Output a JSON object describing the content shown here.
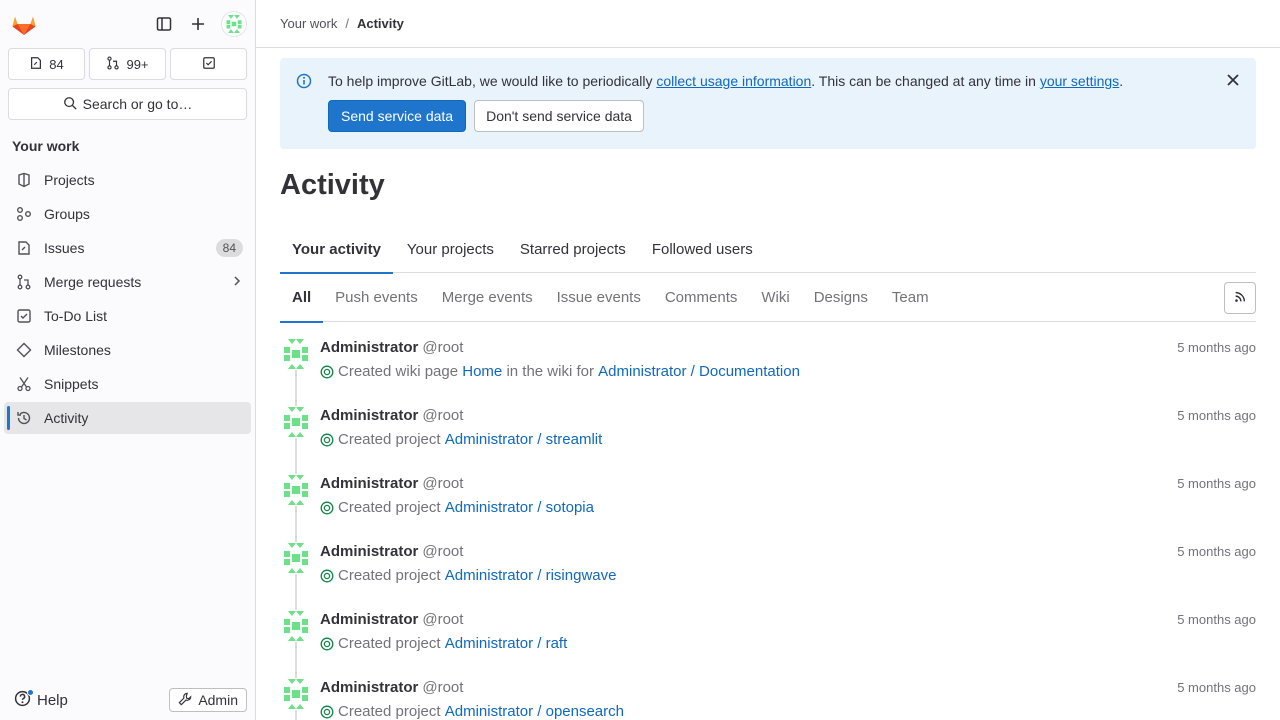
{
  "sidebar": {
    "counts": {
      "issues": "84",
      "merge_requests": "99+"
    },
    "search_label": "Search or go to…",
    "section_title": "Your work",
    "items": [
      {
        "label": "Projects",
        "icon": "project-icon"
      },
      {
        "label": "Groups",
        "icon": "group-icon"
      },
      {
        "label": "Issues",
        "icon": "issues-icon",
        "badge": "84"
      },
      {
        "label": "Merge requests",
        "icon": "merge-request-icon"
      },
      {
        "label": "To-Do List",
        "icon": "todo-icon"
      },
      {
        "label": "Milestones",
        "icon": "milestone-icon"
      },
      {
        "label": "Snippets",
        "icon": "snippet-icon"
      },
      {
        "label": "Activity",
        "icon": "history-icon",
        "active": true
      }
    ],
    "help_label": "Help",
    "admin_label": "Admin"
  },
  "breadcrumb": {
    "parent": "Your work",
    "separator": "/",
    "current": "Activity"
  },
  "alert": {
    "text_before": "To help improve GitLab, we would like to periodically ",
    "link1": "collect usage information",
    "text_middle": ". This can be changed at any time in ",
    "link2": "your settings",
    "text_after": ".",
    "primary_button": "Send service data",
    "secondary_button": "Don't send service data"
  },
  "page_title": "Activity",
  "tabs": [
    "Your activity",
    "Your projects",
    "Starred projects",
    "Followed users"
  ],
  "filters": [
    "All",
    "Push events",
    "Merge events",
    "Issue events",
    "Comments",
    "Wiki",
    "Designs",
    "Team"
  ],
  "events": [
    {
      "name": "Administrator",
      "handle": "@root",
      "time": "5 months ago",
      "action": "Created wiki page",
      "target": "Home",
      "extra": "in the wiki for",
      "project": "Administrator / Documentation"
    },
    {
      "name": "Administrator",
      "handle": "@root",
      "time": "5 months ago",
      "action": "Created project",
      "target": "",
      "extra": "",
      "project": "Administrator / streamlit"
    },
    {
      "name": "Administrator",
      "handle": "@root",
      "time": "5 months ago",
      "action": "Created project",
      "target": "",
      "extra": "",
      "project": "Administrator / sotopia"
    },
    {
      "name": "Administrator",
      "handle": "@root",
      "time": "5 months ago",
      "action": "Created project",
      "target": "",
      "extra": "",
      "project": "Administrator / risingwave"
    },
    {
      "name": "Administrator",
      "handle": "@root",
      "time": "5 months ago",
      "action": "Created project",
      "target": "",
      "extra": "",
      "project": "Administrator / raft"
    },
    {
      "name": "Administrator",
      "handle": "@root",
      "time": "5 months ago",
      "action": "Created project",
      "target": "",
      "extra": "",
      "project": "Administrator / opensearch"
    }
  ],
  "colors": {
    "accent": "#1f75cb",
    "link": "#1068bf",
    "alert_bg": "#e9f3fc",
    "status_green": "#108548",
    "avatar_green": "#6de08a"
  }
}
